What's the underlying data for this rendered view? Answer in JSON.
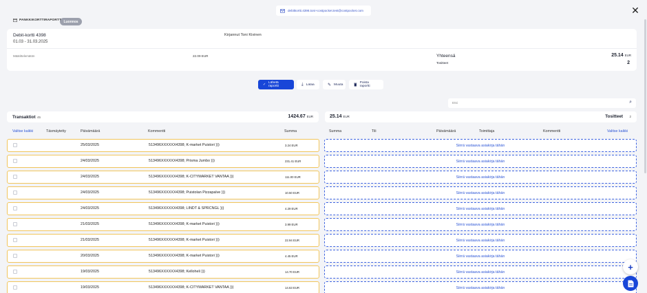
{
  "header": {
    "email": "debitkortti.4398.toni+costpocket.test@costpocket.com",
    "report_type": "PANKKIKORTTIRAPORTTI",
    "status": "Luonnos"
  },
  "summary": {
    "card_name": "Debit-kortti 4398",
    "period": "01.03 - 31.03.2025",
    "signed_by": "Kirjannut Toni Kivinen",
    "markup_label": "Määrittelemätön",
    "markup_value": "22.09 EUR",
    "total_label": "Yhteensä",
    "total_value": "25.14",
    "currency": "EUR",
    "receipts_label": "Tositteet",
    "receipts_value": "2"
  },
  "actions": {
    "send": "Lähetä raportti",
    "download": "Lataa",
    "edit": "Muuta",
    "delete": "Poista raportti"
  },
  "search": {
    "placeholder": "Etsi"
  },
  "transactions": {
    "title": "Transaktiot",
    "count": "45",
    "total": "1424.67",
    "currency": "EUR",
    "columns": {
      "select_all": "Valitse kaikki",
      "matched": "Täsmäytetty",
      "date": "Päivämäärä",
      "comment": "Kommentti",
      "amount": "Summa"
    },
    "rows": [
      {
        "date": "25/03/2025",
        "comment": "513496XXXXXX4398; K-market Puistori )))",
        "amount": "3.24 EUR"
      },
      {
        "date": "24/03/2025",
        "comment": "513496XXXXXX4398; Prisma Jumbo )))",
        "amount": "231.41 EUR"
      },
      {
        "date": "24/03/2025",
        "comment": "513496XXXXXX4398; K-CITYMARKET VANTAA )))",
        "amount": "111.00 EUR"
      },
      {
        "date": "24/03/2025",
        "comment": "513496XXXXXX4398; Puistolan Pizzapalve )))",
        "amount": "10.50 EUR"
      },
      {
        "date": "24/03/2025",
        "comment": "513496XXXXXX4398; LINDT & SPRCNGL )))",
        "amount": "4.29 EUR"
      },
      {
        "date": "21/03/2025",
        "comment": "513496XXXXXX4398; K-market Puistori )))",
        "amount": "3.99 EUR"
      },
      {
        "date": "21/03/2025",
        "comment": "513496XXXXXX4398; K-market Puistori )))",
        "amount": "22.94 EUR"
      },
      {
        "date": "20/03/2025",
        "comment": "513496XXXXXX4398; K-market Puistori )))",
        "amount": "4.45 EUR"
      },
      {
        "date": "19/03/2025",
        "comment": "513496XXXXXX4398; Kelloheli )))",
        "amount": "14.70 EUR"
      },
      {
        "date": "19/03/2025",
        "comment": "513496XXXXXX4398; K-CITYMARKET VANTAA )))",
        "amount": "14.63 EUR"
      }
    ]
  },
  "receipts": {
    "total": "25.14",
    "currency": "EUR",
    "title": "Tositteet",
    "count": "2",
    "columns": {
      "amount": "Summa",
      "account": "Tili",
      "date": "Päivämäärä",
      "supplier": "Toimittaja",
      "comment": "Kommentti",
      "select_all": "Valitse kaikki"
    },
    "drop_text": "Siirrä vastaava asiakirja tähän"
  },
  "icons": {
    "email": "mail-icon",
    "close": "close-icon",
    "report": "card-icon",
    "send": "check-icon",
    "download": "download-icon",
    "edit": "pencil-icon",
    "delete": "trash-icon",
    "search": "search-icon",
    "add": "plus-icon",
    "doc": "document-icon"
  },
  "colors": {
    "primary": "#1846d8",
    "row_border": "#f1c55b",
    "drop_border": "#3d63e0",
    "badge": "#9ca0ad"
  }
}
